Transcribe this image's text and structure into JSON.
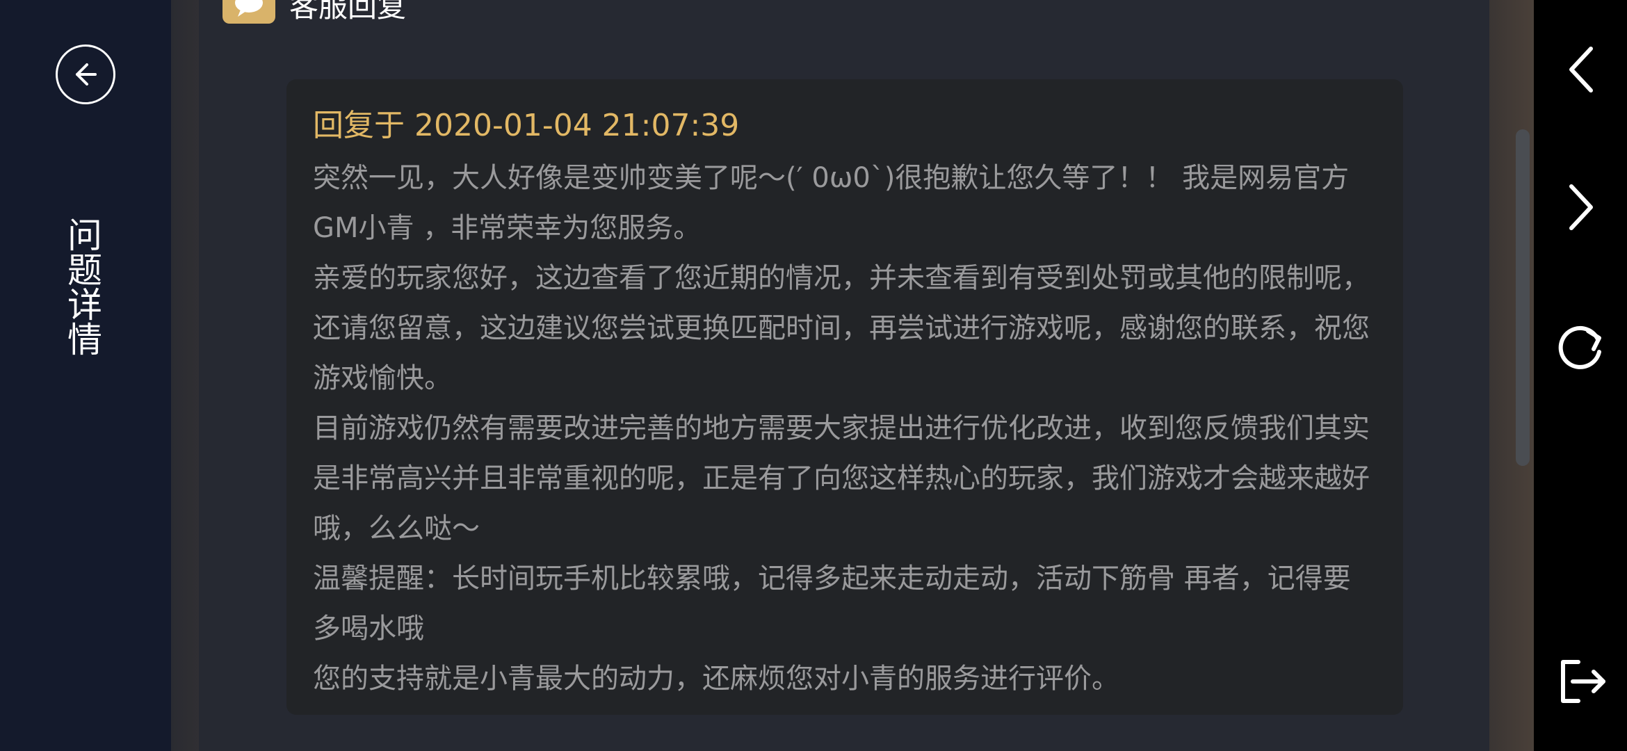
{
  "sidebar": {
    "title": "问题详情",
    "back_icon": "arrow-left-circle-icon"
  },
  "section": {
    "title": "客服回复",
    "icon": "chat-bubble-icon",
    "accent_color": "#d9b36a"
  },
  "reply": {
    "time": "回复于 2020-01-04 21:07:39",
    "paragraphs": [
      "突然一见，大人好像是变帅变美了呢～(′ 0ω0`)很抱歉让您久等了！！ 我是网易官方GM小青 ，非常荣幸为您服务。",
      "亲爱的玩家您好，这边查看了您近期的情况，并未查看到有受到处罚或其他的限制呢，还请您留意，这边建议您尝试更换匹配时间，再尝试进行游戏呢，感谢您的联系，祝您游戏愉快。",
      "目前游戏仍然有需要改进完善的地方需要大家提出进行优化改进，收到您反馈我们其实是非常高兴并且非常重视的呢，正是有了向您这样热心的玩家，我们游戏才会越来越好哦，么么哒～",
      "温馨提醒：长时间玩手机比较累哦，记得多起来走动走动，活动下筋骨 再者，记得要多喝水哦",
      "您的支持就是小青最大的动力，还麻烦您对小青的服务进行评价。"
    ]
  },
  "right_nav": {
    "icons": [
      "chevron-left-icon",
      "chevron-right-icon",
      "refresh-icon",
      "exit-icon"
    ]
  },
  "colors": {
    "time_color": "#e2b865",
    "body_text": "#9a9a9c",
    "sidebar_bg": "#141a2c"
  }
}
